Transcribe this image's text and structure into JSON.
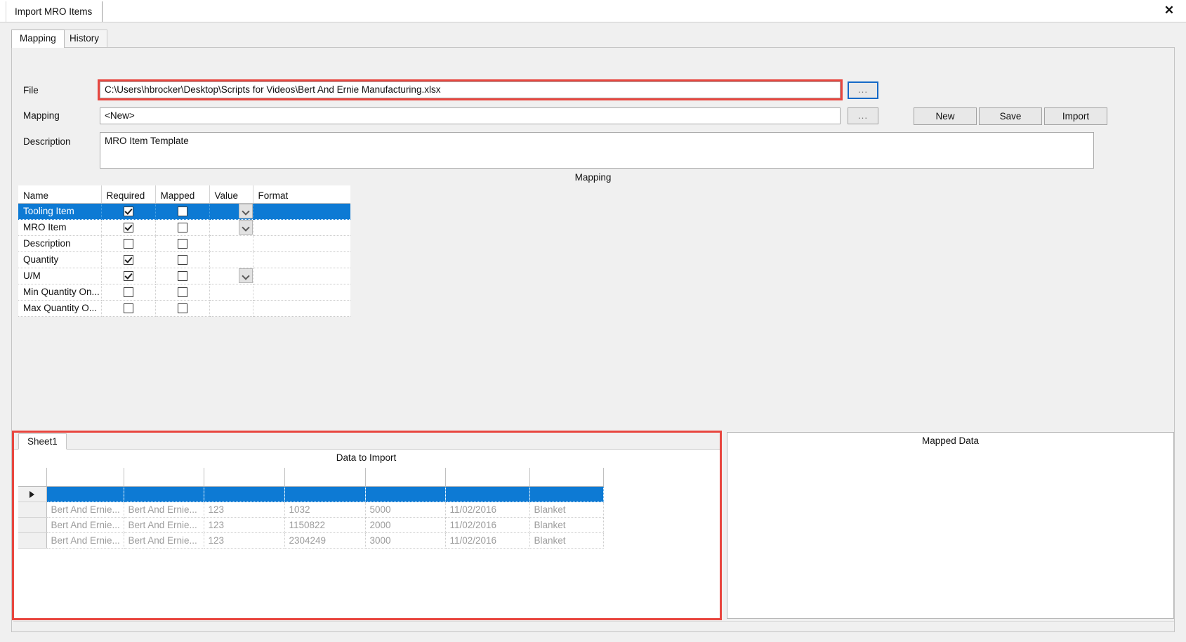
{
  "window": {
    "tab_title": "Import MRO Items",
    "close_icon": "close-x"
  },
  "tabs": [
    {
      "label": "Mapping",
      "active": true
    },
    {
      "label": "History",
      "active": false
    }
  ],
  "form": {
    "file_label": "File",
    "file_value": "C:\\Users\\hbrocker\\Desktop\\Scripts for Videos\\Bert And Ernie Manufacturing.xlsx",
    "file_browse_label": "...",
    "mapping_label": "Mapping",
    "mapping_value": "<New>",
    "mapping_browse_label": "...",
    "description_label": "Description",
    "description_value": "MRO Item Template"
  },
  "actions": {
    "new_label": "New",
    "save_label": "Save",
    "import_label": "Import"
  },
  "mapping_section": {
    "title": "Mapping",
    "columns": [
      "Name",
      "Required",
      "Mapped",
      "Value",
      "Format"
    ],
    "rows": [
      {
        "name": "Tooling Item",
        "required": true,
        "mapped": false,
        "has_dropdown": true,
        "value": "",
        "format": "",
        "selected": true
      },
      {
        "name": "MRO Item",
        "required": true,
        "mapped": false,
        "has_dropdown": true,
        "value": "",
        "format": "",
        "selected": false
      },
      {
        "name": "Description",
        "required": false,
        "mapped": false,
        "has_dropdown": false,
        "value": "",
        "format": "",
        "selected": false
      },
      {
        "name": "Quantity",
        "required": true,
        "mapped": false,
        "has_dropdown": false,
        "value": "",
        "format": "",
        "selected": false
      },
      {
        "name": "U/M",
        "required": true,
        "mapped": false,
        "has_dropdown": true,
        "value": "",
        "format": "",
        "selected": false
      },
      {
        "name": "Min Quantity On...",
        "required": false,
        "mapped": false,
        "has_dropdown": false,
        "value": "",
        "format": "",
        "selected": false
      },
      {
        "name": "Max Quantity O...",
        "required": false,
        "mapped": false,
        "has_dropdown": false,
        "value": "",
        "format": "",
        "selected": false
      }
    ]
  },
  "data_panel": {
    "sheet_tab": "Sheet1",
    "title": "Data to Import",
    "columns": [
      "",
      "",
      "",
      "",
      "",
      "",
      ""
    ],
    "selected_row_marker": "▶",
    "rows": [
      {
        "selected": true,
        "cells": [
          "",
          "",
          "",
          "",
          "",
          "",
          ""
        ]
      },
      {
        "selected": false,
        "cells": [
          "Bert And Ernie...",
          "Bert And Ernie...",
          "123",
          "1032",
          "5000",
          "11/02/2016",
          "Blanket"
        ]
      },
      {
        "selected": false,
        "cells": [
          "Bert And Ernie...",
          "Bert And Ernie...",
          "123",
          "1150822",
          "2000",
          "11/02/2016",
          "Blanket"
        ]
      },
      {
        "selected": false,
        "cells": [
          "Bert And Ernie...",
          "Bert And Ernie...",
          "123",
          "2304249",
          "3000",
          "11/02/2016",
          "Blanket"
        ]
      }
    ]
  },
  "mapped_panel": {
    "title": "Mapped Data"
  },
  "colors": {
    "selection_blue": "#0d7ad4",
    "focus_red": "#e8463f",
    "focus_blue": "#1569c7",
    "chrome_gray": "#f0f0f0"
  }
}
